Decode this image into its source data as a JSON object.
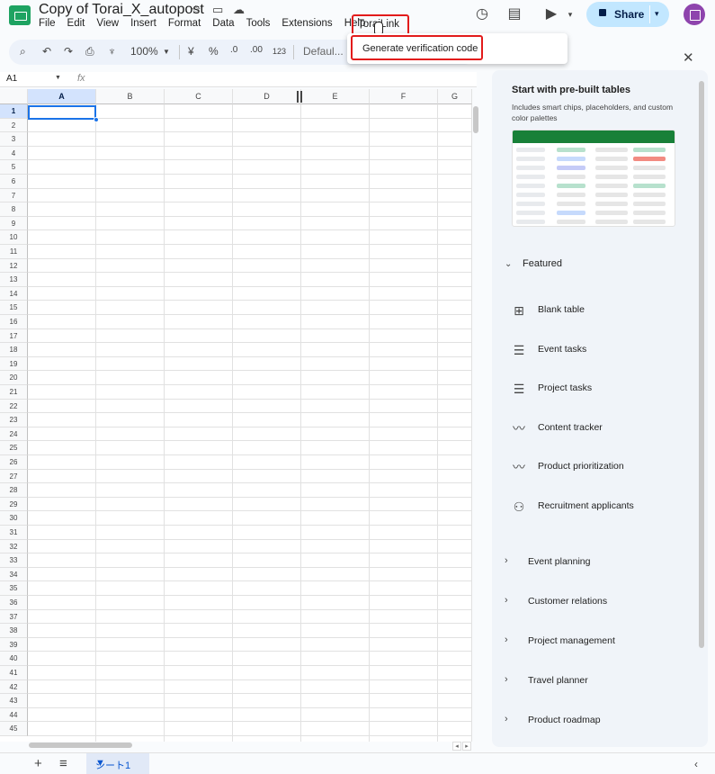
{
  "header": {
    "doc_title": "Copy of Torai_X_autopost",
    "menu": [
      "File",
      "Edit",
      "View",
      "Insert",
      "Format",
      "Data",
      "Tools",
      "Extensions",
      "Help"
    ],
    "torai_menu": "ToraiLink",
    "share_label": "Share"
  },
  "toolbar": {
    "zoom": "100%",
    "currency": "¥",
    "percent": "%",
    "dec_decrease": ".0",
    "dec_increase": ".00",
    "number_format": "123",
    "font": "Defaul..."
  },
  "dropdown": {
    "item": "Generate verification code"
  },
  "formula_bar": {
    "cell_ref": "A1",
    "fx": "fx"
  },
  "grid": {
    "columns": [
      "A",
      "B",
      "C",
      "D",
      "E",
      "F",
      "G"
    ],
    "rows": [
      "1",
      "2",
      "3",
      "4",
      "5",
      "6",
      "7",
      "8",
      "9",
      "10",
      "11",
      "12",
      "13",
      "14",
      "15",
      "16",
      "17",
      "18",
      "19",
      "20",
      "21",
      "22",
      "23",
      "24",
      "25",
      "26",
      "27",
      "28",
      "29",
      "30",
      "31",
      "32",
      "33",
      "34",
      "35",
      "36",
      "37",
      "38",
      "39",
      "40",
      "41",
      "42",
      "43",
      "44",
      "45"
    ]
  },
  "sheets": {
    "active": "シート1"
  },
  "panel": {
    "title": "Start with pre-built tables",
    "subtitle": "Includes smart chips, placeholders, and custom color palettes",
    "featured_label": "Featured",
    "templates": [
      {
        "label": "Blank table",
        "icon": "table-icon"
      },
      {
        "label": "Event tasks",
        "icon": "checklist-icon"
      },
      {
        "label": "Project tasks",
        "icon": "checklist-icon"
      },
      {
        "label": "Content tracker",
        "icon": "trend-icon"
      },
      {
        "label": "Product prioritization",
        "icon": "trend-icon"
      },
      {
        "label": "Recruitment applicants",
        "icon": "person-icon"
      }
    ],
    "categories": [
      "Event planning",
      "Customer relations",
      "Project management",
      "Travel planner",
      "Product roadmap"
    ]
  }
}
